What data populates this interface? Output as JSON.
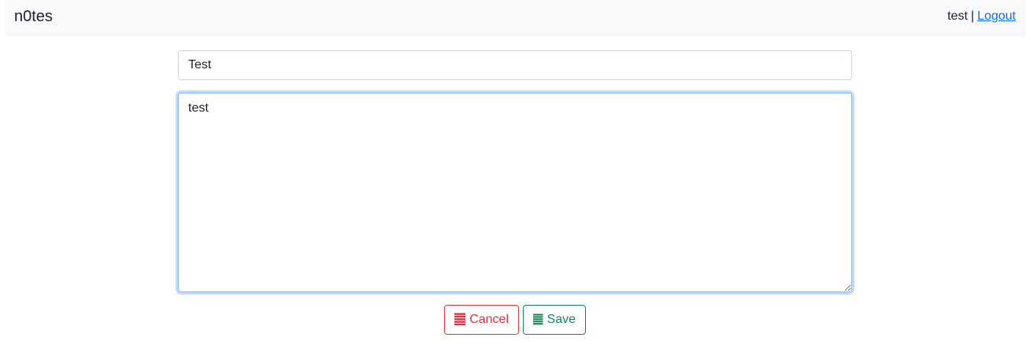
{
  "app": {
    "brand": "n0tes"
  },
  "header": {
    "username": "test",
    "separator": "|",
    "logout_label": "Logout"
  },
  "editor": {
    "title_value": "Test",
    "body_value": "test"
  },
  "actions": {
    "cancel_label": "Cancel",
    "cancel_icon": "list-icon",
    "save_label": "Save",
    "save_icon": "list-icon"
  },
  "colors": {
    "cancel": "#dc3545",
    "save": "#198754",
    "link": "#0d6efd",
    "navbar_bg": "#f8f9fa"
  }
}
